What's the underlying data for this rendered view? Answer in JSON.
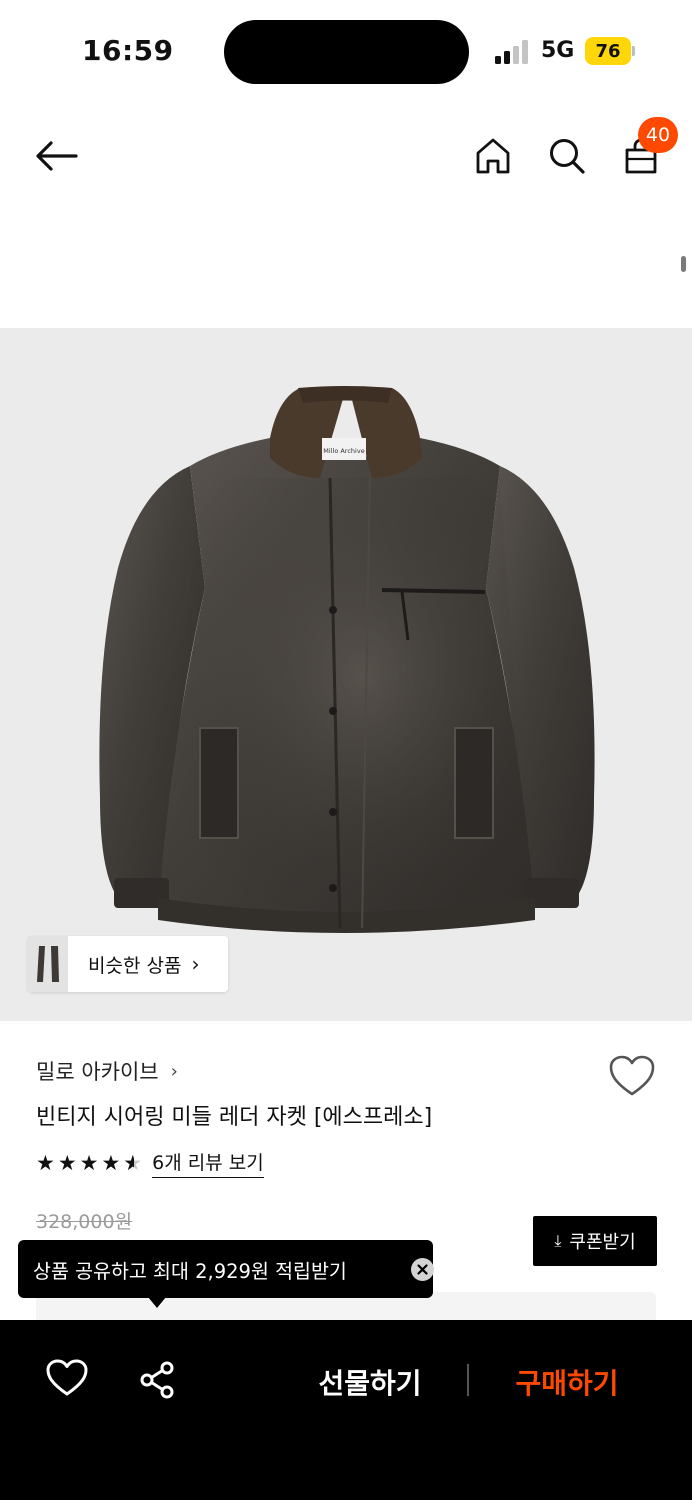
{
  "status_bar": {
    "time": "16:59",
    "network": "5G",
    "battery": "76"
  },
  "nav": {
    "cart_count": "40"
  },
  "product_image": {
    "tag_text": "Millo Archive"
  },
  "similar": {
    "label": "비슷한 상품",
    "chevron": "›"
  },
  "product": {
    "brand": "밀로 아카이브",
    "brand_chevron": "›",
    "title": "빈티지 시어링 미들 레더 자켓 [에스프레소]",
    "rating": 4.5,
    "review_link": "6개 리뷰 보기",
    "original_price": "328,000원"
  },
  "coupon": {
    "label": "쿠폰받기",
    "icon": "download-icon"
  },
  "tooltip": {
    "text": "상품 공유하고 최대 2,929원 적립받기"
  },
  "bottom_bar": {
    "gift_label": "선물하기",
    "buy_label": "구매하기"
  },
  "colors": {
    "accent": "#ff4800",
    "badge": "#ff4800",
    "battery": "#ffd60a",
    "image_bg": "#ebebeb"
  }
}
